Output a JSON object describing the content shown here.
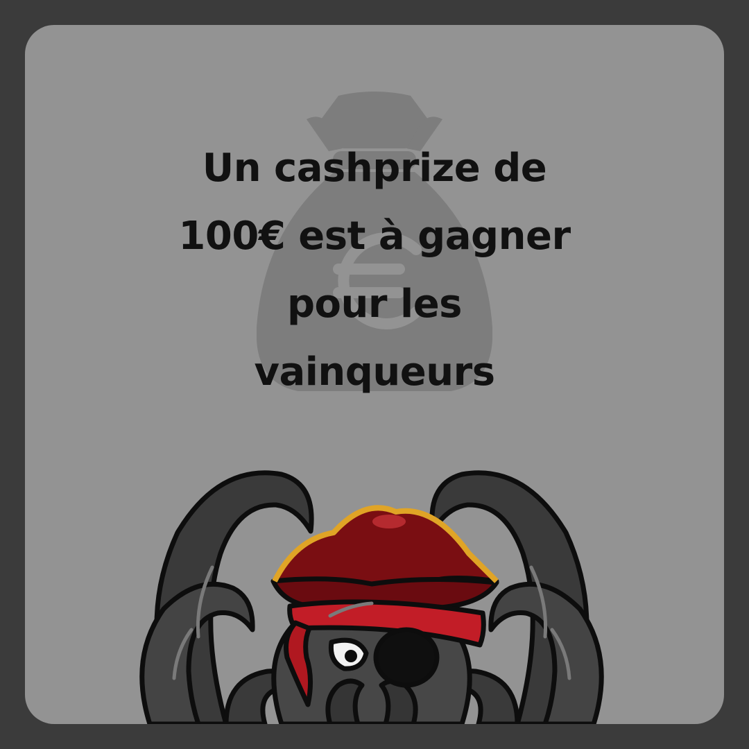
{
  "headline": {
    "lines": [
      "Un cashprize de",
      "100€ est à gagner",
      "pour les",
      "vainqueurs"
    ]
  },
  "illustration": {
    "background_icon": "euro-money-bag-icon",
    "mascot": "pirate-octopus-mascot"
  },
  "colors": {
    "frame": "#3b3b3b",
    "card": "#939393",
    "headline_text": "#111111",
    "money_bag": "#7d7d7d",
    "octopus": "#3c3c3c",
    "hat": "#7a0e12",
    "hat_trim": "#e0a426",
    "bandana": "#c21d27"
  }
}
